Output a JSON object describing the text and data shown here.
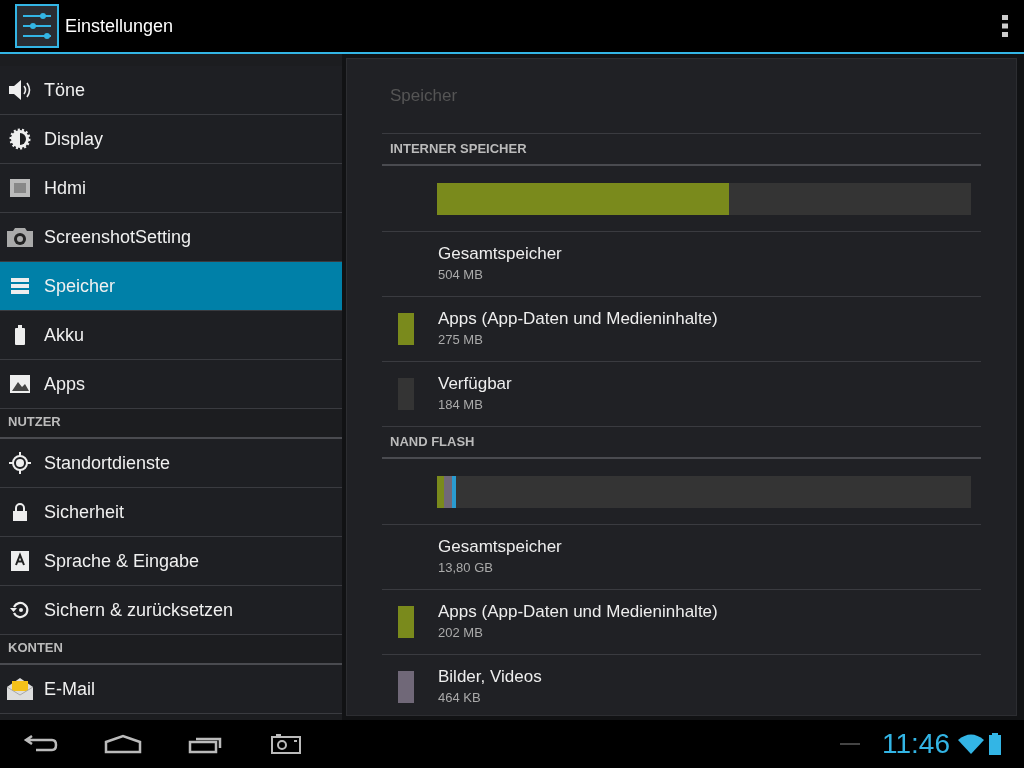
{
  "action_bar": {
    "title": "Einstellungen"
  },
  "sidebar": {
    "sections": [
      {
        "items": [
          {
            "kind": "sound",
            "label": "Töne",
            "selected": false
          },
          {
            "kind": "display",
            "label": "Display",
            "selected": false
          },
          {
            "kind": "hdmi",
            "label": "Hdmi",
            "selected": false
          },
          {
            "kind": "camera",
            "label": "ScreenshotSetting",
            "selected": false
          },
          {
            "kind": "storage",
            "label": "Speicher",
            "selected": true
          },
          {
            "kind": "battery",
            "label": "Akku",
            "selected": false
          },
          {
            "kind": "apps",
            "label": "Apps",
            "selected": false
          }
        ]
      },
      {
        "header": "NUTZER",
        "items": [
          {
            "kind": "location",
            "label": "Standortdienste",
            "selected": false
          },
          {
            "kind": "lock",
            "label": "Sicherheit",
            "selected": false
          },
          {
            "kind": "language",
            "label": "Sprache & Eingabe",
            "selected": false
          },
          {
            "kind": "restore",
            "label": "Sichern & zurücksetzen",
            "selected": false
          }
        ]
      },
      {
        "header": "KONTEN",
        "items": [
          {
            "kind": "mail",
            "label": "E-Mail",
            "selected": false
          }
        ]
      }
    ]
  },
  "detail": {
    "title": "Speicher",
    "volumes": [
      {
        "header": "INTERNER SPEICHER",
        "segments": [
          {
            "color": "#7a8a1c",
            "level": 0.546
          }
        ],
        "rows": [
          {
            "kind": "total",
            "title": "Gesamtspeicher",
            "value": "504 MB"
          },
          {
            "kind": "segment",
            "color": "#7a8a1c",
            "title": "Apps (App-Daten und Medieninhalte)",
            "value": "275 MB"
          },
          {
            "kind": "segment",
            "color": "#343434",
            "title": "Verfügbar",
            "value": "184 MB"
          }
        ]
      },
      {
        "header": "NAND FLASH",
        "segments": [
          {
            "color": "#7a8a1c",
            "level": 0.013
          },
          {
            "color": "#706878",
            "level": 0.015
          },
          {
            "color": "#2a9bd0",
            "level": 0.007
          }
        ],
        "rows": [
          {
            "kind": "total",
            "title": "Gesamtspeicher",
            "value": "13,80 GB"
          },
          {
            "kind": "segment",
            "color": "#7a8a1c",
            "title": "Apps (App-Daten und Medieninhalte)",
            "value": "202 MB"
          },
          {
            "kind": "segment",
            "color": "#706878",
            "title": "Bilder, Videos",
            "value": "464 KB"
          }
        ]
      }
    ]
  },
  "status_bar": {
    "time": "11:46"
  }
}
